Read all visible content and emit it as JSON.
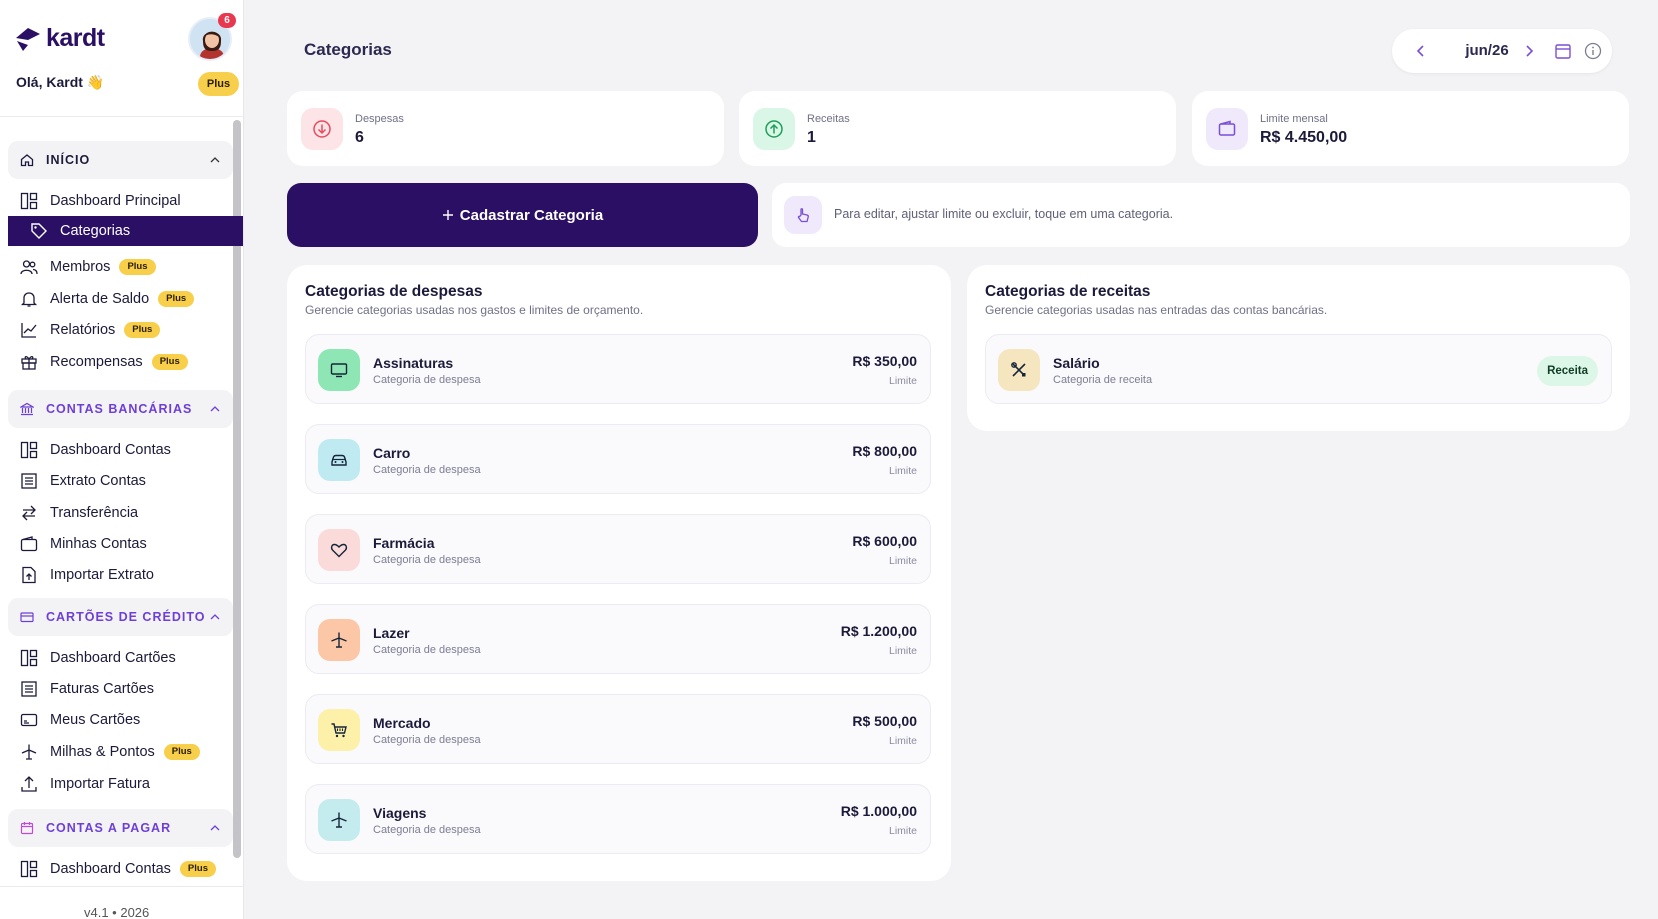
{
  "brand": {
    "name": "kardt",
    "color": "#2a0f64"
  },
  "user": {
    "greeting": "Olá, Kardt 👋",
    "notifications": "6",
    "plan": "Plus"
  },
  "sidebar": {
    "sections": [
      {
        "label": "INÍCIO",
        "icon": "home-icon"
      },
      {
        "label": "CONTAS BANCÁRIAS",
        "icon": "bank-icon"
      },
      {
        "label": "CARTÕES DE CRÉDITO",
        "icon": "credit-card-icon"
      },
      {
        "label": "CONTAS A PAGAR",
        "icon": "calendar-icon"
      }
    ],
    "items": [
      {
        "label": "Dashboard Principal",
        "icon": "dashboard-icon"
      },
      {
        "label": "Categorias",
        "icon": "tag-icon",
        "active": true
      },
      {
        "label": "Membros",
        "icon": "users-icon",
        "badge": "Plus"
      },
      {
        "label": "Alerta de Saldo",
        "icon": "bell-icon",
        "badge": "Plus"
      },
      {
        "label": "Relatórios",
        "icon": "chart-line-icon",
        "badge": "Plus"
      },
      {
        "label": "Recompensas",
        "icon": "gift-icon",
        "badge": "Plus"
      },
      {
        "label": "Dashboard Contas",
        "icon": "dashboard-icon"
      },
      {
        "label": "Extrato Contas",
        "icon": "list-icon"
      },
      {
        "label": "Transferência",
        "icon": "transfer-icon"
      },
      {
        "label": "Minhas Contas",
        "icon": "wallet-icon"
      },
      {
        "label": "Importar Extrato",
        "icon": "file-import-icon"
      },
      {
        "label": "Dashboard Cartões",
        "icon": "dashboard-icon"
      },
      {
        "label": "Faturas Cartões",
        "icon": "list-icon"
      },
      {
        "label": "Meus Cartões",
        "icon": "card-icon"
      },
      {
        "label": "Milhas & Pontos",
        "icon": "plane-icon",
        "badge": "Plus"
      },
      {
        "label": "Importar Fatura",
        "icon": "upload-icon"
      },
      {
        "label": "Dashboard Contas",
        "icon": "dashboard-icon",
        "badge": "Plus"
      }
    ],
    "version": "v4.1 • 2026"
  },
  "header": {
    "title": "Categorias",
    "month": "jun/26"
  },
  "stats": [
    {
      "label": "Despesas",
      "value": "6",
      "icon": "arrow-down-circle-icon",
      "color": "#e84a5f"
    },
    {
      "label": "Receitas",
      "value": "1",
      "icon": "arrow-up-circle-icon",
      "color": "#1e9e5b"
    },
    {
      "label": "Limite mensal",
      "value": "R$ 4.450,00",
      "icon": "wallet-icon",
      "color": "#7a4fd6"
    }
  ],
  "actions": {
    "create_label": "Cadastrar Categoria",
    "hint": "Para editar, ajustar limite ou excluir, toque em uma categoria."
  },
  "expenses": {
    "title": "Categorias de despesas",
    "subtitle": "Gerencie categorias usadas nos gastos e limites de orçamento.",
    "items": [
      {
        "name": "Assinaturas",
        "type": "Categoria de despesa",
        "amount": "R$ 350,00",
        "limit_label": "Limite",
        "icon": "monitor-icon",
        "bg": "#8ee6b4"
      },
      {
        "name": "Carro",
        "type": "Categoria de despesa",
        "amount": "R$ 800,00",
        "limit_label": "Limite",
        "icon": "car-icon",
        "bg": "#bfeaf2"
      },
      {
        "name": "Farmácia",
        "type": "Categoria de despesa",
        "amount": "R$ 600,00",
        "limit_label": "Limite",
        "icon": "heart-icon",
        "bg": "#fbdada"
      },
      {
        "name": "Lazer",
        "type": "Categoria de despesa",
        "amount": "R$ 1.200,00",
        "limit_label": "Limite",
        "icon": "plane-icon",
        "bg": "#fbc7a6"
      },
      {
        "name": "Mercado",
        "type": "Categoria de despesa",
        "amount": "R$ 500,00",
        "limit_label": "Limite",
        "icon": "cart-icon",
        "bg": "#fdf0a8"
      },
      {
        "name": "Viagens",
        "type": "Categoria de despesa",
        "amount": "R$ 1.000,00",
        "limit_label": "Limite",
        "icon": "plane-icon",
        "bg": "#c4ecef"
      }
    ]
  },
  "incomes": {
    "title": "Categorias de receitas",
    "subtitle": "Gerencie categorias usadas nas entradas das contas bancárias.",
    "items": [
      {
        "name": "Salário",
        "type": "Categoria de receita",
        "badge": "Receita",
        "icon": "tools-icon",
        "bg": "#f6e6bf"
      }
    ]
  }
}
